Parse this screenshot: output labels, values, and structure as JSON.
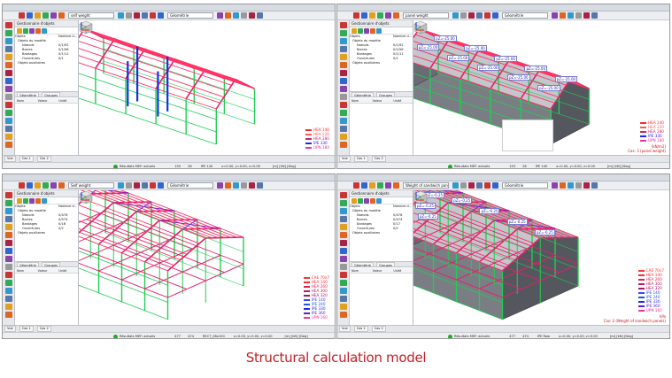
{
  "caption": "Structural calculation model",
  "windows": [
    {
      "id": "tl",
      "combo": "self weight",
      "combo2": "Géométrie",
      "panel_title": "Gestionnaire d'objets",
      "tree_header": [
        "Objets",
        "Nombre d..."
      ],
      "tree": [
        {
          "label": "Objets du modèle",
          "count": ""
        },
        {
          "label": "Noeuds",
          "count": "0/1/92"
        },
        {
          "label": "Barres",
          "count": "0/1/56"
        },
        {
          "label": "Bardages",
          "count": "0/1/11"
        },
        {
          "label": "Ouvertures",
          "count": "0/1"
        },
        {
          "label": "Objets auxiliaires",
          "count": ""
        }
      ],
      "tabs": [
        "Géométrie",
        "Groupes"
      ],
      "props_head": [
        "Nom",
        "Valeur",
        "Unité"
      ],
      "status_tabs": [
        "Vue",
        "Cas 1",
        "Cas 2"
      ],
      "status": {
        "results": "Résultats MEF: actuels",
        "v1": "155",
        "v2": "26",
        "sect": "IPE 140",
        "pos": "x=0.00, y=0.00, z=0.00",
        "units": "[m] [kN] [Deg]"
      },
      "legend": [
        {
          "name": "HEA 140",
          "color": "#ff2a2a"
        },
        {
          "name": "HEA 220",
          "color": "#ff5a5a"
        },
        {
          "name": "HEA 280",
          "color": "#d21e64"
        },
        {
          "name": "IPE 330",
          "color": "#2222ff"
        },
        {
          "name": "UPN 180",
          "color": "#ee3399"
        }
      ],
      "case_note": "",
      "load_labels": []
    },
    {
      "id": "tr",
      "combo": "panel weight",
      "combo2": "Géométrie",
      "panel_title": "Gestionnaire d'objets",
      "tree_header": [
        "Objets",
        "Nombre d..."
      ],
      "tree": [
        {
          "label": "Objets du modèle",
          "count": ""
        },
        {
          "label": "Noeuds",
          "count": "0/1/92"
        },
        {
          "label": "Barres",
          "count": "0/1/56"
        },
        {
          "label": "Bardages",
          "count": "0/1/11"
        },
        {
          "label": "Ouvertures",
          "count": "0/1"
        },
        {
          "label": "Objets auxiliaires",
          "count": ""
        }
      ],
      "tabs": [
        "Géométrie",
        "Groupes"
      ],
      "props_head": [
        "Nom",
        "Valeur",
        "Unité"
      ],
      "status_tabs": [
        "Vue",
        "Cas 1",
        "Cas 2"
      ],
      "status": {
        "results": "Résultats MEF: actuels",
        "v1": "153",
        "v2": "26",
        "sect": "IPE 140",
        "pos": "x=0.00, y=0.00, z=0.00",
        "units": "[m] [kN] [Deg]"
      },
      "legend": [
        {
          "name": "HEA 140",
          "color": "#ff2a2a"
        },
        {
          "name": "HEA 220",
          "color": "#ff5a5a"
        },
        {
          "name": "HEA 280",
          "color": "#d21e64"
        },
        {
          "name": "IPE 330",
          "color": "#2222ff"
        },
        {
          "name": "UPN 180",
          "color": "#ee3399"
        }
      ],
      "case_note": "Cas: 3 (panel weight)",
      "case_unit": "[kN/m2]",
      "load_labels": [
        "pZ=-25.00",
        "pZ=-25.00",
        "pZ=-25.00",
        "pZ=-25.00",
        "pZ=-25.00",
        "pZ=-25.00",
        "pZ=-25.00",
        "pZ=-25.00",
        "pZ=-25.00",
        "pZ=-25.00"
      ]
    },
    {
      "id": "bl",
      "combo": "Self weight",
      "combo2": "Géométrie",
      "panel_title": "Gestionnaire d'objets",
      "tree_header": [
        "Objets",
        "Nombre d..."
      ],
      "tree": [
        {
          "label": "Objets du modèle",
          "count": ""
        },
        {
          "label": "Noeuds",
          "count": "0/476"
        },
        {
          "label": "Barres",
          "count": "0/474"
        },
        {
          "label": "Bardages",
          "count": "0/16"
        },
        {
          "label": "Ouvertures",
          "count": "0/2"
        },
        {
          "label": "Objets auxiliaires",
          "count": ""
        }
      ],
      "tabs": [
        "Géométrie",
        "Groupes"
      ],
      "props_head": [
        "Nom",
        "Valeur",
        "Unité"
      ],
      "status_tabs": [
        "Vue",
        "Cas 1",
        "Cas 2"
      ],
      "status": {
        "results": "Résultats MEF: actuels",
        "v1": "477",
        "v2": "474",
        "sect": "RECT_08x150",
        "pos": "x=0.00, y=0.00, z=0.00",
        "units": "[m] [kN] [Deg]"
      },
      "legend": [
        {
          "name": "CAE 70x7",
          "color": "#ff3333"
        },
        {
          "name": "HEA 140",
          "color": "#ff2a2a"
        },
        {
          "name": "HEA 260",
          "color": "#e01f50"
        },
        {
          "name": "HEA 300",
          "color": "#c0185a"
        },
        {
          "name": "HEA 320",
          "color": "#aa1166"
        },
        {
          "name": "IPE 140",
          "color": "#3344ff"
        },
        {
          "name": "IPE 240",
          "color": "#2255dd"
        },
        {
          "name": "IPE 330",
          "color": "#2222ff"
        },
        {
          "name": "IPE 360",
          "color": "#5522cc"
        },
        {
          "name": "UPN 160",
          "color": "#ee3399"
        }
      ],
      "case_note": "",
      "load_labels": []
    },
    {
      "id": "br",
      "combo": "Weight of sandwich panels",
      "combo2": "Géométrie",
      "panel_title": "Gestionnaire d'objets",
      "tree_header": [
        "Objets",
        "Nombre d..."
      ],
      "tree": [
        {
          "label": "Objets du modèle",
          "count": ""
        },
        {
          "label": "Noeuds",
          "count": "0/476"
        },
        {
          "label": "Barres",
          "count": "0/474"
        },
        {
          "label": "Bardages",
          "count": "0/17"
        },
        {
          "label": "Ouvertures",
          "count": "0/2"
        },
        {
          "label": "Objets auxiliaires",
          "count": ""
        }
      ],
      "tabs": [
        "Géométrie",
        "Groupes"
      ],
      "props_head": [
        "Nom",
        "Valeur",
        "Unité"
      ],
      "status_tabs": [
        "Vue",
        "Cas 1",
        "Cas 2"
      ],
      "status": {
        "results": "Résultats MEF: actuels",
        "v1": "477",
        "v2": "474",
        "sect": "IPE Row",
        "pos": "x=0.00, y=0.00, z=0.00",
        "units": "[m] [kN] [Deg]"
      },
      "legend": [
        {
          "name": "CAE 70x7",
          "color": "#ff3333"
        },
        {
          "name": "HEA 140",
          "color": "#ff2a2a"
        },
        {
          "name": "HEA 260",
          "color": "#e01f50"
        },
        {
          "name": "HEA 300",
          "color": "#c0185a"
        },
        {
          "name": "HEA 320",
          "color": "#aa1166"
        },
        {
          "name": "IPE 140",
          "color": "#3344ff"
        },
        {
          "name": "IPE 240",
          "color": "#2255dd"
        },
        {
          "name": "IPE 330",
          "color": "#2222ff"
        },
        {
          "name": "IPE 360",
          "color": "#5522cc"
        },
        {
          "name": "UPN 160",
          "color": "#ee3399"
        }
      ],
      "case_note": "Cas: 2 (Weight of sandwich panels)",
      "case_unit": "kPa",
      "load_labels": [
        "pZ=-0.25",
        "pZ=-0.25",
        "pZ=-0.25",
        "pZ=-0.25",
        "pZ=-0.25",
        "pZ=-0.25",
        "pZ=-0.25"
      ]
    }
  ],
  "colors": {
    "column": "#22cc55",
    "beam": "#e0206a",
    "purlin": "#ff3366",
    "brace": "#7722cc",
    "panel": "#7b7d84",
    "panel_dark": "#55575e",
    "blue_member": "#1133dd",
    "caption": "#c2202a"
  }
}
